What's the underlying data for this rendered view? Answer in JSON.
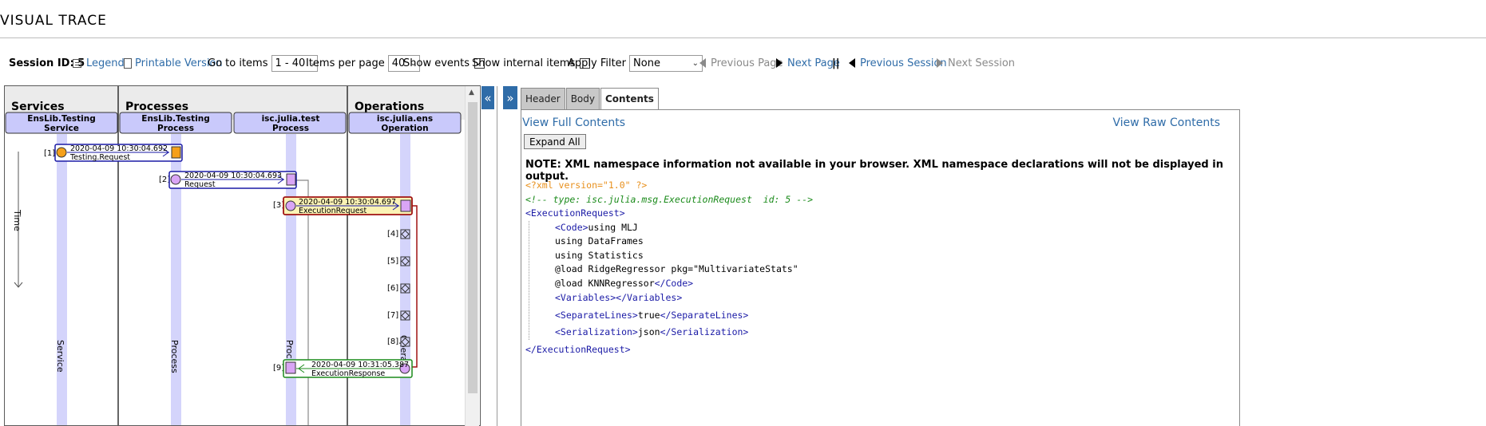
{
  "page": {
    "title": "VISUAL TRACE"
  },
  "toolbar": {
    "session_id_label": "Session ID: 5",
    "legend": "Legend",
    "printable": "Printable Version",
    "goto_label": "Go to items",
    "goto_value": "1 - 40",
    "per_page_label": "Items per page",
    "per_page_value": "40",
    "show_events_label": "Show events",
    "show_events_checked": "✓",
    "show_internal_label": "Show internal items",
    "apply_filter_label": "Apply Filter",
    "filter_value": "None",
    "prev_page": "Previous Page",
    "next_page": "Next Page",
    "separator": "||",
    "prev_session": "Previous Session",
    "next_session": "Next Session"
  },
  "trace": {
    "time_label": "Time",
    "headers": {
      "services": "Services",
      "processes": "Processes",
      "operations": "Operations"
    },
    "columns": [
      {
        "line1": "EnsLib.Testing",
        "line2": "Service",
        "lane_label": "Service"
      },
      {
        "line1": "EnsLib.Testing",
        "line2": "Process",
        "lane_label": "Process"
      },
      {
        "line1": "isc.julia.test",
        "line2": "Process",
        "lane_label": "Proc"
      },
      {
        "line1": "isc.julia.ens",
        "line2": "Operation",
        "lane_label": "Opera"
      }
    ],
    "messages": [
      {
        "index": "[1]",
        "time": "2020-04-09 10:30:04.692",
        "name": "Testing.Request"
      },
      {
        "index": "[2]",
        "time": "2020-04-09 10:30:04.693",
        "name": "Request"
      },
      {
        "index": "[3]",
        "time": "2020-04-09 10:30:04.697",
        "name": "ExecutionRequest"
      },
      {
        "index": "[9]",
        "time": "2020-04-09 10:31:05.387",
        "name": "ExecutionResponse"
      }
    ],
    "events": [
      "[4]",
      "[5]",
      "[6]",
      "[7]",
      "[8]"
    ],
    "colors": {
      "header_bg": "#c9c9fb",
      "lane": "#d4d4fb",
      "request": "#1a1aa6",
      "highlight": "#fbf3b5",
      "selected_border": "#a01212",
      "response": "#1b8b1b",
      "service_dot": "#f5a01a",
      "process_dot": "#d9a5f5"
    }
  },
  "details": {
    "tabs": [
      "Header",
      "Body",
      "Contents"
    ],
    "active_tab": "Contents",
    "view_full": "View Full Contents",
    "view_raw": "View Raw Contents",
    "expand_all": "Expand All",
    "note": "NOTE: XML namespace information not available in your browser. XML namespace declarations will not be displayed in output.",
    "xml": {
      "pi": "<?xml version=\"1.0\" ?>",
      "comment": "<!-- type: isc.julia.msg.ExecutionRequest  id: 5 -->",
      "root_open": "<ExecutionRequest>",
      "code_open": "<Code>",
      "code_lines": [
        "using MLJ",
        "using DataFrames",
        "using Statistics",
        "@load RidgeRegressor pkg=\"MultivariateStats\"",
        "@load KNNRegressor"
      ],
      "code_close": "</Code>",
      "variables": "<Variables></Variables>",
      "sep_open": "<SeparateLines>",
      "sep_value": "true",
      "sep_close": "</SeparateLines>",
      "ser_open": "<Serialization>",
      "ser_value": "json",
      "ser_close": "</Serialization>",
      "root_close": "</ExecutionRequest>"
    }
  }
}
